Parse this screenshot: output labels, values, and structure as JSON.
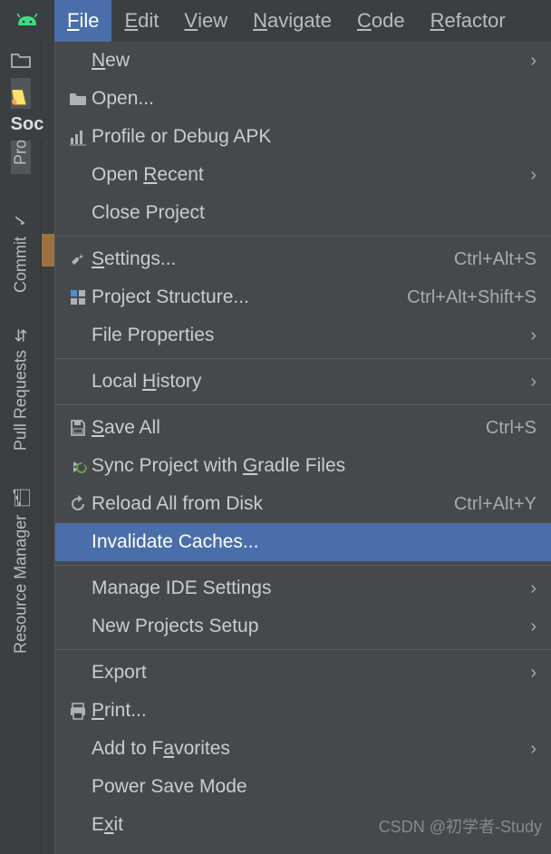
{
  "menubar": {
    "items": [
      {
        "label": "File",
        "mnemonic": "F",
        "active": true
      },
      {
        "label": "Edit",
        "mnemonic": "E"
      },
      {
        "label": "View",
        "mnemonic": "V"
      },
      {
        "label": "Navigate",
        "mnemonic": "N"
      },
      {
        "label": "Code",
        "mnemonic": "C"
      },
      {
        "label": "Refactor",
        "mnemonic": "R"
      }
    ]
  },
  "left_rail": {
    "project_label": "Soc",
    "tabs": [
      {
        "label": "Project",
        "active": true
      },
      {
        "label": "Commit"
      },
      {
        "label": "Pull Requests"
      },
      {
        "label": "Resource Manager"
      }
    ]
  },
  "file_menu": {
    "groups": [
      [
        {
          "label": "New",
          "mnemonic": "N",
          "icon": "",
          "submenu": true
        },
        {
          "label": "Open...",
          "icon": "folder"
        },
        {
          "label": "Profile or Debug APK",
          "icon": "chart"
        },
        {
          "label": "Open Recent",
          "mnemonic": "R",
          "submenu": true
        },
        {
          "label": "Close Project"
        }
      ],
      [
        {
          "label": "Settings...",
          "mnemonic": "S",
          "icon": "wrench",
          "shortcut": "Ctrl+Alt+S"
        },
        {
          "label": "Project Structure...",
          "icon": "structure",
          "shortcut": "Ctrl+Alt+Shift+S"
        },
        {
          "label": "File Properties",
          "submenu": true
        }
      ],
      [
        {
          "label": "Local History",
          "mnemonic": "H",
          "submenu": true
        }
      ],
      [
        {
          "label": "Save All",
          "mnemonic": "S",
          "icon": "save",
          "shortcut": "Ctrl+S"
        },
        {
          "label": "Sync Project with Gradle Files",
          "mnemonic": "G",
          "icon": "sync-gradle"
        },
        {
          "label": "Reload All from Disk",
          "icon": "reload",
          "shortcut": "Ctrl+Alt+Y"
        },
        {
          "label": "Invalidate Caches...",
          "highlight": true
        }
      ],
      [
        {
          "label": "Manage IDE Settings",
          "submenu": true
        },
        {
          "label": "New Projects Setup",
          "submenu": true
        }
      ],
      [
        {
          "label": "Export",
          "submenu": true
        },
        {
          "label": "Print...",
          "mnemonic": "P",
          "icon": "print"
        },
        {
          "label": "Add to Favorites",
          "mnemonic": "a",
          "submenu": true
        },
        {
          "label": "Power Save Mode"
        },
        {
          "label": "Exit",
          "mnemonic": "x"
        }
      ]
    ]
  },
  "watermark": "CSDN @初学者-Study"
}
